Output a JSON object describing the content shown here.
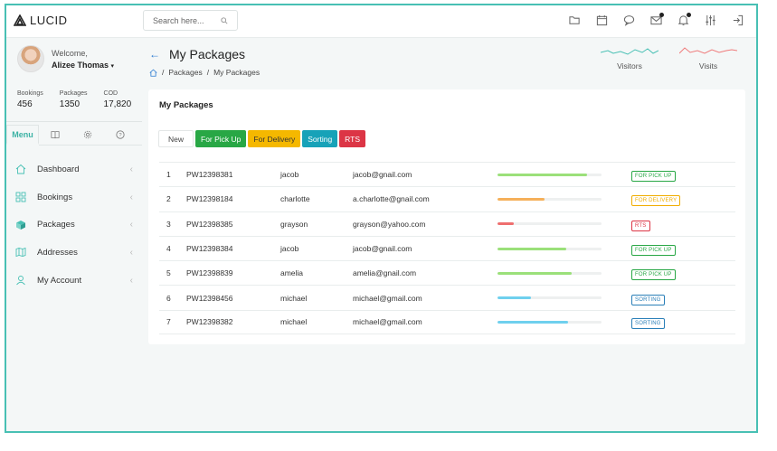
{
  "app": {
    "name": "LUCID"
  },
  "search": {
    "placeholder": "Search here..."
  },
  "topbar": {
    "icons": [
      "folder-icon",
      "calendar-icon",
      "chat-icon",
      "mail-icon",
      "bell-icon",
      "sliders-icon",
      "logout-icon"
    ]
  },
  "user": {
    "welcome": "Welcome,",
    "name": "Alizee Thomas",
    "caret": "▾"
  },
  "stats": [
    {
      "label": "Bookings",
      "value": "456"
    },
    {
      "label": "Packages",
      "value": "1350"
    },
    {
      "label": "COD",
      "value": "17,820"
    }
  ],
  "sidebar_tabs": {
    "menu": "Menu"
  },
  "nav": [
    {
      "label": "Dashboard",
      "icon": "home-icon"
    },
    {
      "label": "Bookings",
      "icon": "grid-icon"
    },
    {
      "label": "Packages",
      "icon": "cube-icon"
    },
    {
      "label": "Addresses",
      "icon": "map-icon"
    },
    {
      "label": "My Account",
      "icon": "user-icon"
    }
  ],
  "page": {
    "title": "My Packages",
    "breadcrumb": [
      "Packages",
      "My Packages"
    ],
    "separator": "/"
  },
  "sparks": [
    {
      "label": "Visitors",
      "color": "#48c0b4"
    },
    {
      "label": "Visits",
      "color": "#ef7b7b"
    }
  ],
  "card": {
    "title": "My Packages"
  },
  "filters": [
    {
      "label": "New",
      "color": "#ffffff"
    },
    {
      "label": "For Pick Up",
      "color": "#28a745"
    },
    {
      "label": "For Delivery",
      "color": "#f5b800"
    },
    {
      "label": "Sorting",
      "color": "#17a2b8"
    },
    {
      "label": "RTS",
      "color": "#dc3545"
    }
  ],
  "packages": [
    {
      "num": "1",
      "id": "PW12398381",
      "name": "jacob",
      "email": "jacob@gnail.com",
      "progress": 0.86,
      "status": "FOR PICK UP",
      "bar_color": "#9be07a",
      "status_color": "#28a745"
    },
    {
      "num": "2",
      "id": "PW12398184",
      "name": "charlotte",
      "email": "a.charlotte@gnail.com",
      "progress": 0.45,
      "status": "FOR DELIVERY",
      "bar_color": "#f5b05a",
      "status_color": "#f0ad00"
    },
    {
      "num": "3",
      "id": "PW12398385",
      "name": "grayson",
      "email": "grayson@yahoo.com",
      "progress": 0.16,
      "status": "RTS",
      "bar_color": "#ef6f6f",
      "status_color": "#dc3545"
    },
    {
      "num": "4",
      "id": "PW12398384",
      "name": "jacob",
      "email": "jacob@gnail.com",
      "progress": 0.66,
      "status": "FOR PICK UP",
      "bar_color": "#9be07a",
      "status_color": "#28a745"
    },
    {
      "num": "5",
      "id": "PW12398839",
      "name": "amelia",
      "email": "amelia@gnail.com",
      "progress": 0.71,
      "status": "FOR PICK UP",
      "bar_color": "#9be07a",
      "status_color": "#28a745"
    },
    {
      "num": "6",
      "id": "PW12398456",
      "name": "michael",
      "email": "michael@gmail.com",
      "progress": 0.32,
      "status": "SORTING",
      "bar_color": "#6fd0ee",
      "status_color": "#2a7fb8"
    },
    {
      "num": "7",
      "id": "PW12398382",
      "name": "michael",
      "email": "michael@gmail.com",
      "progress": 0.68,
      "status": "SORTING",
      "bar_color": "#6fd0ee",
      "status_color": "#2a7fb8"
    }
  ]
}
